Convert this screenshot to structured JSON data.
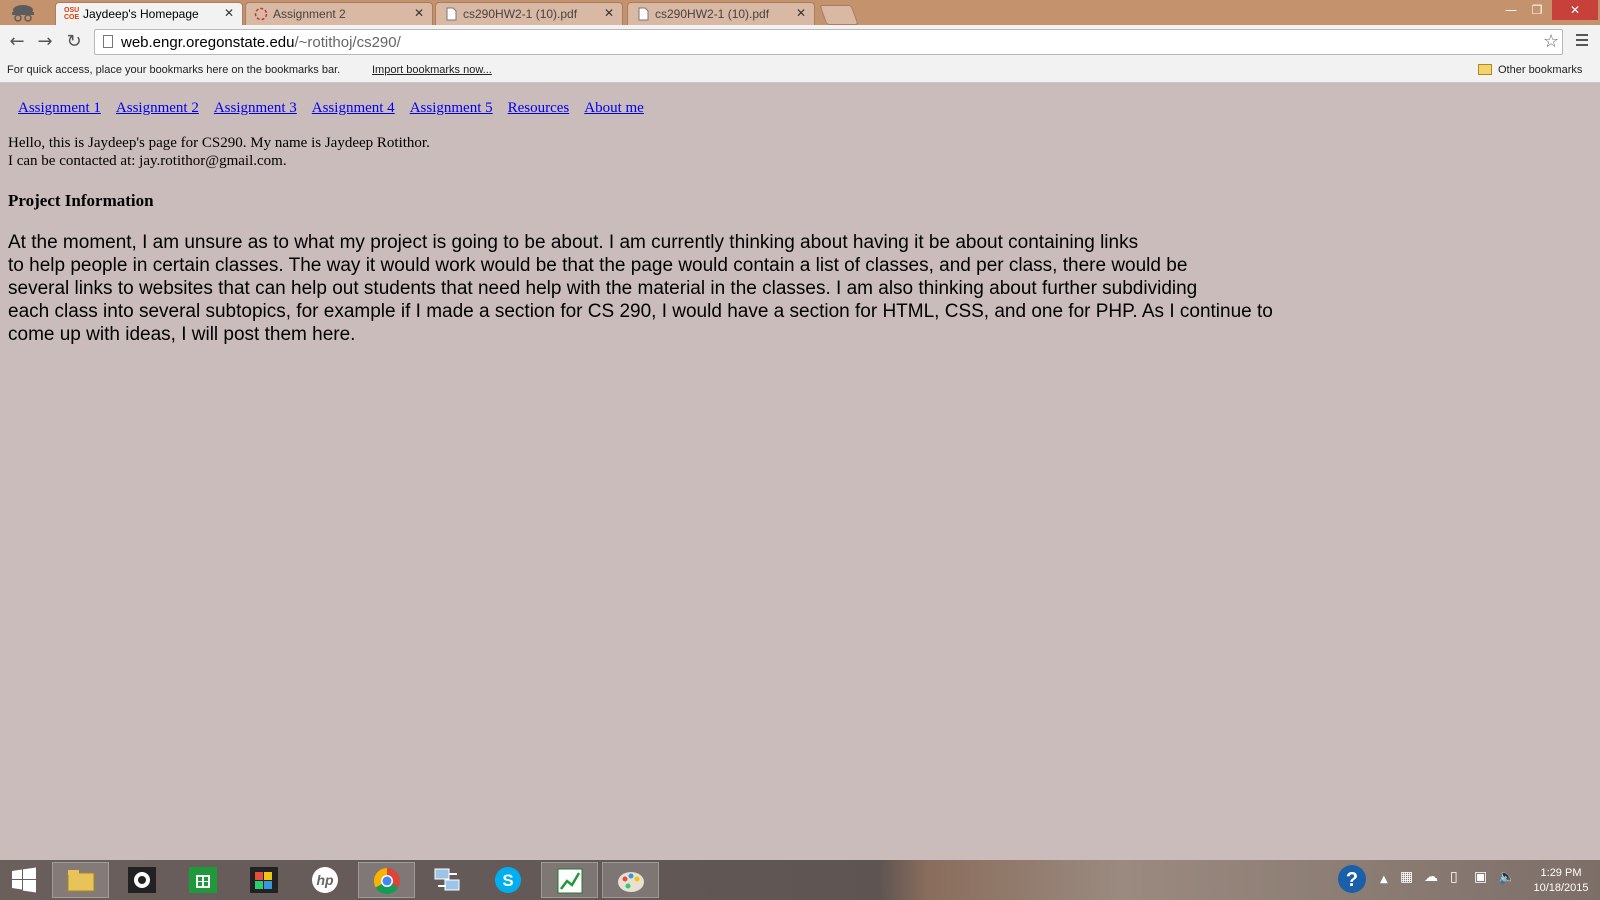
{
  "browser": {
    "tabs": [
      {
        "label": "Jaydeep's Homepage",
        "active": true
      },
      {
        "label": "Assignment 2",
        "active": false
      },
      {
        "label": "cs290HW2-1 (10).pdf",
        "active": false
      },
      {
        "label": "cs290HW2-1 (10).pdf",
        "active": false
      }
    ],
    "favicon_text": "OSU COE",
    "url_host": "web.engr.oregonstate.edu",
    "url_path": "/~rotithoj/cs290/",
    "bookmarks_hint": "For quick access, place your bookmarks here on the bookmarks bar.",
    "import_link": "Import bookmarks now...",
    "other_bookmarks": "Other bookmarks"
  },
  "page": {
    "nav": [
      "Assignment 1",
      "Assignment 2",
      "Assignment 3",
      "Assignment 4",
      "Assignment 5",
      "Resources",
      "About me"
    ],
    "intro_line1": "Hello, this is Jaydeep's page for CS290. My name is Jaydeep Rotithor.",
    "intro_line2": "I can be contacted at: jay.rotithor@gmail.com.",
    "heading": "Project Information",
    "project_lines": [
      "At the moment, I am unsure as to what my project is going to be about. I am currently thinking about having it be about containing links",
      "to help people in certain classes. The way it would work would be that the page would contain a list of classes, and per class, there would be",
      "several links to websites that can help out students that need help with the material in the classes. I am also thinking about further subdividing",
      "each class into several subtopics, for example if I made a section for CS 290, I would have a section for HTML, CSS, and one for PHP. As I continue to",
      "come up with ideas, I will post them here."
    ]
  },
  "taskbar": {
    "time": "1:29 PM",
    "date": "10/18/2015",
    "apps": [
      "start-icon",
      "file-explorer-icon",
      "camera-icon",
      "store-icon",
      "photo-app-icon",
      "hp-icon",
      "chrome-icon",
      "network-tool-icon",
      "skype-icon",
      "chart-app-icon",
      "paint-icon"
    ],
    "help_icon_label": "?"
  },
  "colors": {
    "page_background": "#cbbcbc",
    "titlebar": "#c4926d",
    "link": "#0000ee"
  }
}
